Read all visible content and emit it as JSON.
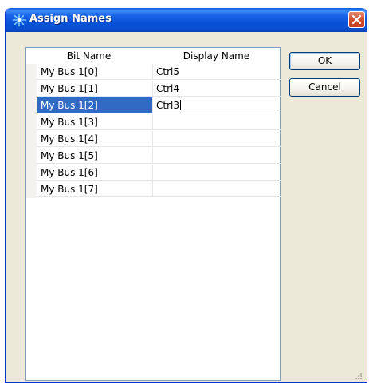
{
  "window": {
    "title": "Assign Names",
    "colors": {
      "titlebar": "#0853d8",
      "selection": "#316ac5",
      "close": "#d1502f"
    }
  },
  "grid": {
    "columns": [
      "Bit Name",
      "Display Name"
    ],
    "rows": [
      {
        "bit_name": "My Bus 1[0]",
        "display_name": "Ctrl5"
      },
      {
        "bit_name": "My Bus 1[1]",
        "display_name": "Ctrl4"
      },
      {
        "bit_name": "My Bus 1[2]",
        "display_name": "Ctrl3"
      },
      {
        "bit_name": "My Bus 1[3]",
        "display_name": ""
      },
      {
        "bit_name": "My Bus 1[4]",
        "display_name": ""
      },
      {
        "bit_name": "My Bus 1[5]",
        "display_name": ""
      },
      {
        "bit_name": "My Bus 1[6]",
        "display_name": ""
      },
      {
        "bit_name": "My Bus 1[7]",
        "display_name": ""
      }
    ],
    "selected_row": 2
  },
  "buttons": {
    "ok": "OK",
    "cancel": "Cancel"
  },
  "icons": {
    "app": "asterisk-app-icon",
    "close": "close-icon",
    "resize": "resize-grip-icon"
  }
}
